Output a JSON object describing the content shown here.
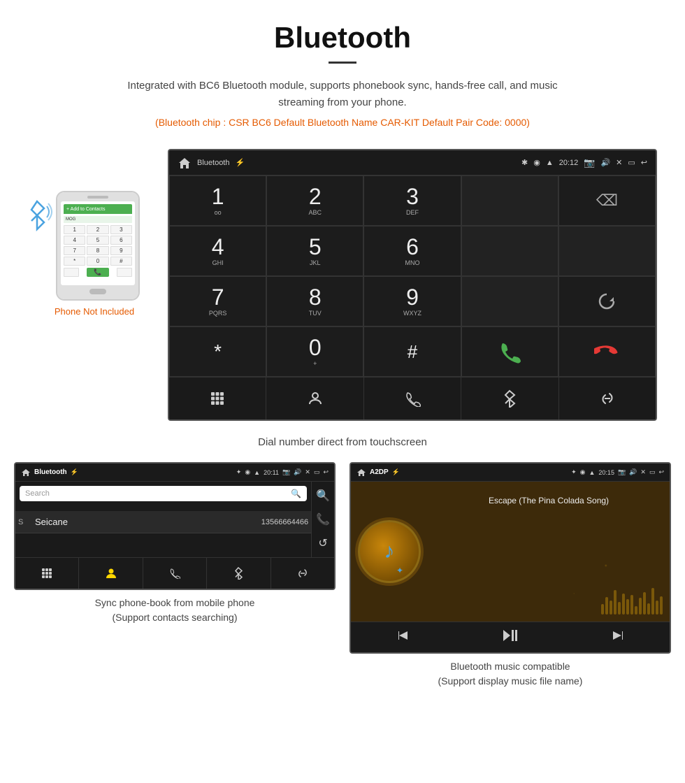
{
  "header": {
    "title": "Bluetooth",
    "subtitle": "Integrated with BC6 Bluetooth module, supports phonebook sync, hands-free call, and music streaming from your phone.",
    "specs": "(Bluetooth chip : CSR BC6    Default Bluetooth Name CAR-KIT    Default Pair Code: 0000)"
  },
  "phone_label": "Phone Not Included",
  "big_screen": {
    "status_bar": {
      "app_name": "Bluetooth",
      "time": "20:12"
    },
    "dialpad": [
      {
        "num": "1",
        "letters": "oo"
      },
      {
        "num": "2",
        "letters": "ABC"
      },
      {
        "num": "3",
        "letters": "DEF"
      },
      {
        "num": "",
        "letters": ""
      },
      {
        "num": "⌫",
        "letters": ""
      },
      {
        "num": "4",
        "letters": "GHI"
      },
      {
        "num": "5",
        "letters": "JKL"
      },
      {
        "num": "6",
        "letters": "MNO"
      },
      {
        "num": "",
        "letters": ""
      },
      {
        "num": "",
        "letters": ""
      },
      {
        "num": "7",
        "letters": "PQRS"
      },
      {
        "num": "8",
        "letters": "TUV"
      },
      {
        "num": "9",
        "letters": "WXYZ"
      },
      {
        "num": "",
        "letters": ""
      },
      {
        "num": "↺",
        "letters": ""
      },
      {
        "num": "*",
        "letters": ""
      },
      {
        "num": "0",
        "letters": "+"
      },
      {
        "num": "#",
        "letters": ""
      },
      {
        "num": "📞",
        "letters": ""
      },
      {
        "num": "📵",
        "letters": ""
      }
    ]
  },
  "caption_main": "Dial number direct from touchscreen",
  "phonebook_screen": {
    "status_bar": {
      "app_name": "Bluetooth",
      "time": "20:11"
    },
    "search_placeholder": "Search",
    "contacts": [
      {
        "letter": "S",
        "name": "Seicane",
        "number": "13566664466"
      }
    ]
  },
  "music_screen": {
    "status_bar": {
      "app_name": "A2DP",
      "time": "20:15"
    },
    "track_title": "Escape (The Pina Colada Song)"
  },
  "bottom_captions": {
    "left_title": "Sync phone-book from mobile phone",
    "left_sub": "(Support contacts searching)",
    "right_title": "Bluetooth music compatible",
    "right_sub": "(Support display music file name)"
  }
}
